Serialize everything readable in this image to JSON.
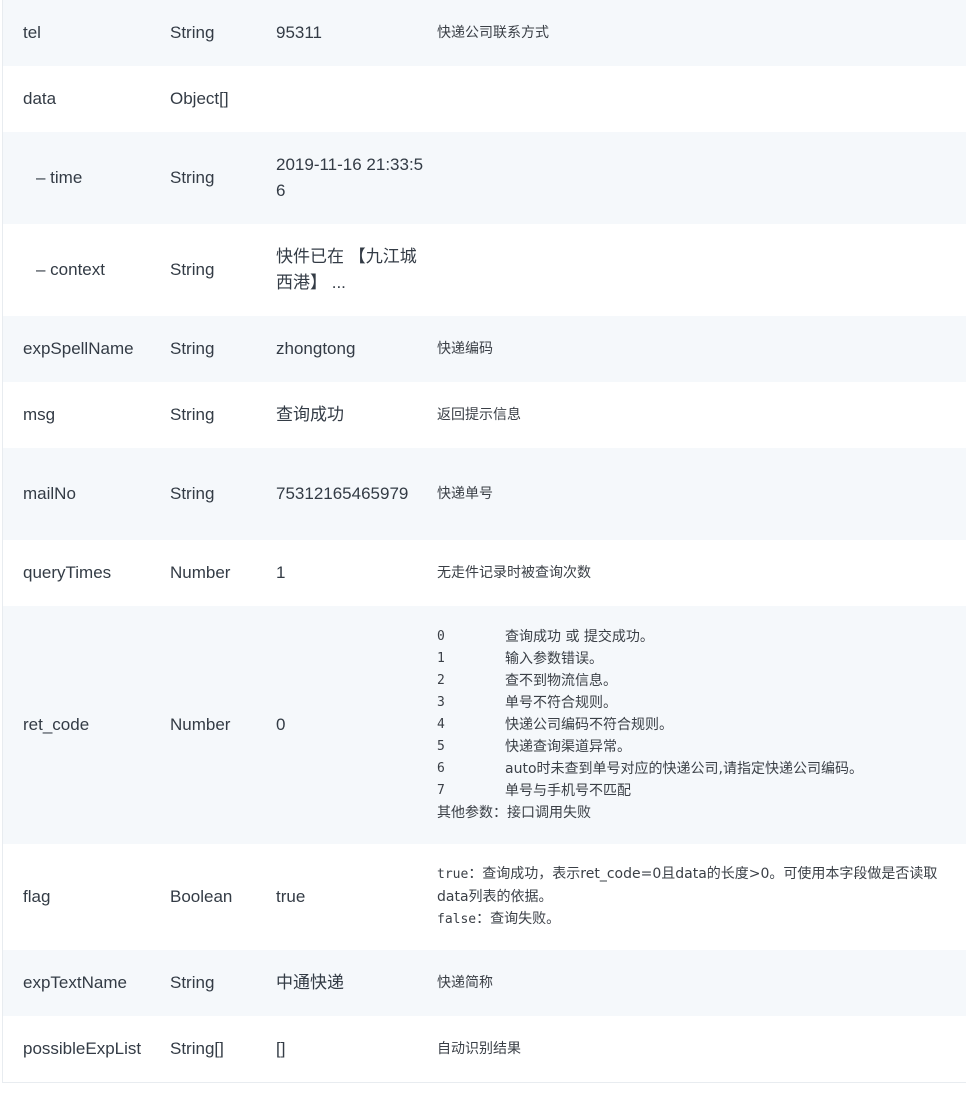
{
  "rows": [
    {
      "name": "tel",
      "type": "String",
      "example": "95311",
      "desc": "快递公司联系方式"
    },
    {
      "name": "data",
      "type": "Object[]",
      "example": "",
      "desc": ""
    },
    {
      "name": "– time",
      "type": "String",
      "example": "2019-11-16 21:33:56",
      "desc": ""
    },
    {
      "name": "– context",
      "type": "String",
      "example": "快件已在 【九江城西港】 ...",
      "desc": ""
    },
    {
      "name": "expSpellName",
      "type": "String",
      "example": "zhongtong",
      "desc": "快递编码"
    },
    {
      "name": "msg",
      "type": "String",
      "example": "查询成功",
      "desc": "返回提示信息"
    },
    {
      "name": "mailNo",
      "type": "String",
      "example": "75312165465979",
      "desc": "快递单号"
    },
    {
      "name": "queryTimes",
      "type": "Number",
      "example": "1",
      "desc": "无走件记录时被查询次数"
    },
    {
      "name": "ret_code",
      "type": "Number",
      "example": "0",
      "codes": [
        {
          "code": "0",
          "text": "查询成功 或 提交成功。"
        },
        {
          "code": "1",
          "text": "输入参数错误。"
        },
        {
          "code": "2",
          "text": "查不到物流信息。"
        },
        {
          "code": "3",
          "text": "单号不符合规则。"
        },
        {
          "code": "4",
          "text": "快递公司编码不符合规则。"
        },
        {
          "code": "5",
          "text": "快递查询渠道异常。"
        },
        {
          "code": "6",
          "text": "auto时未查到单号对应的快递公司,请指定快递公司编码。"
        },
        {
          "code": "7",
          "text": "单号与手机号不匹配"
        }
      ],
      "other": "其他参数：接口调用失败"
    },
    {
      "name": "flag",
      "type": "Boolean",
      "example": "true",
      "desc_true_key": "true",
      "desc_true_text": "：查询成功，表示ret_code=0且data的长度>0。可使用本字段做是否读取data列表的依据。",
      "desc_false_key": "false",
      "desc_false_text": "：查询失败。"
    },
    {
      "name": "expTextName",
      "type": "String",
      "example": "中通快递",
      "desc": "快递简称"
    },
    {
      "name": "possibleExpList",
      "type": "String[]",
      "example": "[]",
      "desc": "自动识别结果"
    }
  ]
}
